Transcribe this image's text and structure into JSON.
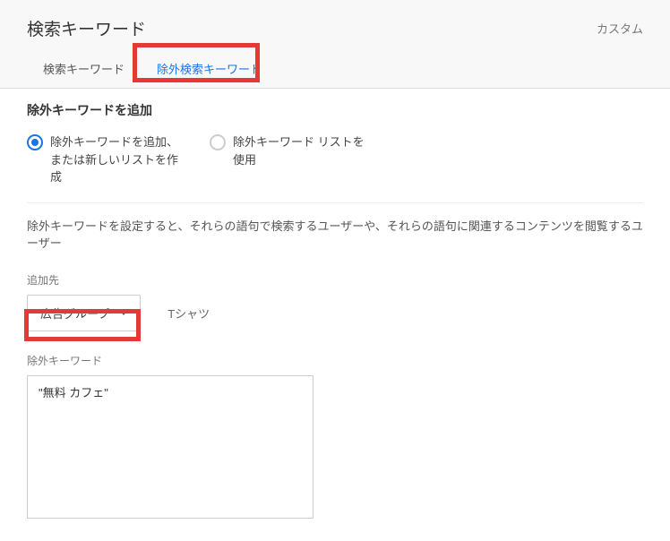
{
  "header": {
    "title": "検索キーワード",
    "custom_link": "カスタム"
  },
  "tabs": {
    "search": "検索キーワード",
    "negative": "除外検索キーワード"
  },
  "section": {
    "title": "除外キーワードを追加",
    "radio_add": "除外キーワードを追加、または新しいリストを作成",
    "radio_use": "除外キーワード リストを使用",
    "description": "除外キーワードを設定すると、それらの語句で検索するユーザーや、それらの語句に関連するコンテンツを閲覧するユーザー"
  },
  "add_target": {
    "label": "追加先",
    "dropdown": "広告グループ",
    "target_name": "Tシャツ"
  },
  "negative_keywords": {
    "label": "除外キーワード",
    "value": "\"無料 カフェ\""
  }
}
